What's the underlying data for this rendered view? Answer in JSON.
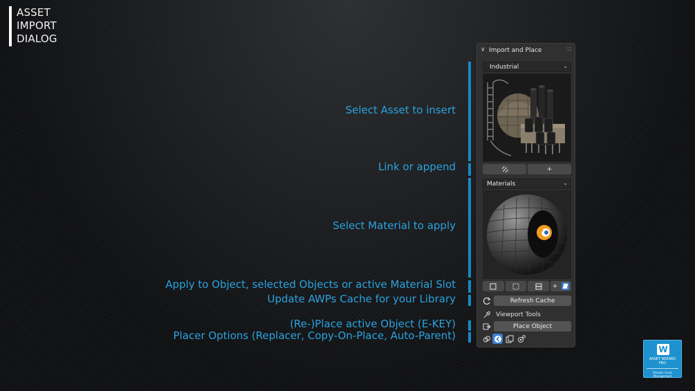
{
  "title_lines": [
    "ASSET",
    "IMPORT",
    "DIALOG"
  ],
  "callouts": {
    "select_asset": "Select Asset to insert",
    "link_append": "Link or append",
    "select_material": "Select Material to apply",
    "apply_to": "Apply to Object, selected Objects or active Material Slot",
    "update_cache": "Update AWPs Cache for your Library",
    "replace": "(Re-)Place active Object (E-KEY)",
    "placer_options": "Placer Options (Replacer, Copy-On-Place, Auto-Parent)"
  },
  "panel": {
    "header": "Import and Place",
    "asset_category": "Industrial",
    "material_category": "Materials",
    "link_plus_label": "+",
    "apply_plus_label": "+",
    "refresh_cache": "Refresh Cache",
    "viewport_tools": "Viewport Tools",
    "place_object": "Place Object"
  },
  "icons": {
    "collapse": "chevron-down-icon",
    "grip": "drag-grip-icon",
    "link": "link-broken-icon",
    "refresh": "refresh-icon",
    "viewport": "viewport-tools-icon",
    "place": "place-object-icon",
    "replacer": "replacer-icon",
    "copy_on_place": "copy-on-place-icon",
    "auto_parent": "auto-parent-icon"
  },
  "badge": {
    "logo": "W",
    "line1": "ASSET WIZARD",
    "line2": "PRO",
    "line3": "Blender Asset Management"
  },
  "colors": {
    "accent": "#2aa3df",
    "bar": "#1788c4",
    "panel_bg": "#303030",
    "button": "#545454",
    "badge_bg": "#1e91cf"
  }
}
